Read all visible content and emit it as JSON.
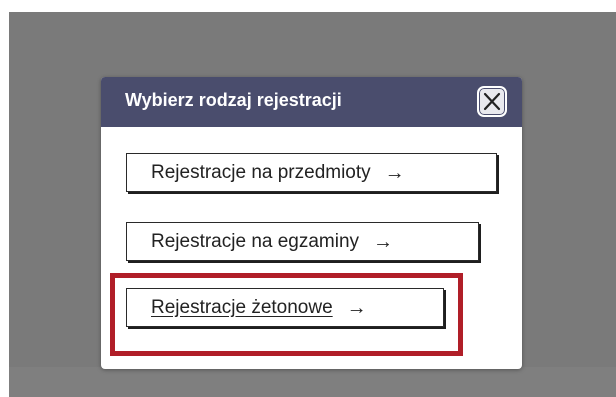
{
  "dialog": {
    "title": "Wybierz rodzaj rejestracji",
    "close_icon": "close-icon"
  },
  "options": [
    {
      "label": "Rejestracje na przedmioty",
      "arrow": "→"
    },
    {
      "label": "Rejestracje na egzaminy",
      "arrow": "→"
    },
    {
      "label": "Rejestracje żetonowe",
      "arrow": "→"
    }
  ],
  "colors": {
    "header_background": "#4a4d6d",
    "overlay": "#7a7a7a",
    "highlight": "#b01e28"
  }
}
